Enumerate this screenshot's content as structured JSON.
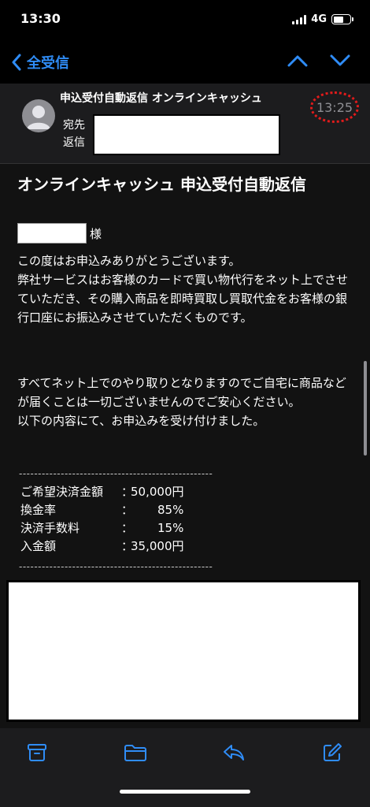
{
  "status": {
    "time": "13:30",
    "network": "4G",
    "battery_level": 0.6
  },
  "nav": {
    "back_label": "全受信"
  },
  "header": {
    "subject": "申込受付自動返信 オンラインキャッシュ",
    "time": "13:25",
    "to_label": "宛先",
    "reply_label": "返信"
  },
  "email": {
    "title": "オンラインキャッシュ 申込受付自動返信",
    "honorific": "様",
    "para1": "この度はお申込みありがとうございます。\n弊社サービスはお客様のカードで買い物代行をネット上でさせていただき、その購入商品を即時買取し買取代金をお客様の銀行口座にお振込みさせていただくものです。",
    "para2": "すべてネット上でのやり取りとなりますのでご自宅に商品などが届くことは一切ございませんのでご安心ください。\n以下の内容にて、お申込みを受け付けました。",
    "divider": "---------------------------------------------------",
    "rows": [
      {
        "label": "ご希望決済金額",
        "colon": "：",
        "value": "50,000円"
      },
      {
        "label": "換金率",
        "colon": "：",
        "value": "85%"
      },
      {
        "label": "決済手数料",
        "colon": "：",
        "value": "15%"
      },
      {
        "label": "入金額",
        "colon": "：",
        "value": "35,000円"
      }
    ]
  },
  "colors": {
    "accent": "#2f8cf6",
    "highlight": "#e21b1b",
    "background": "#121212",
    "header": "#1c1c1e"
  },
  "toolbar": {
    "icons": [
      "archive-icon",
      "folder-icon",
      "reply-icon",
      "compose-icon"
    ]
  }
}
